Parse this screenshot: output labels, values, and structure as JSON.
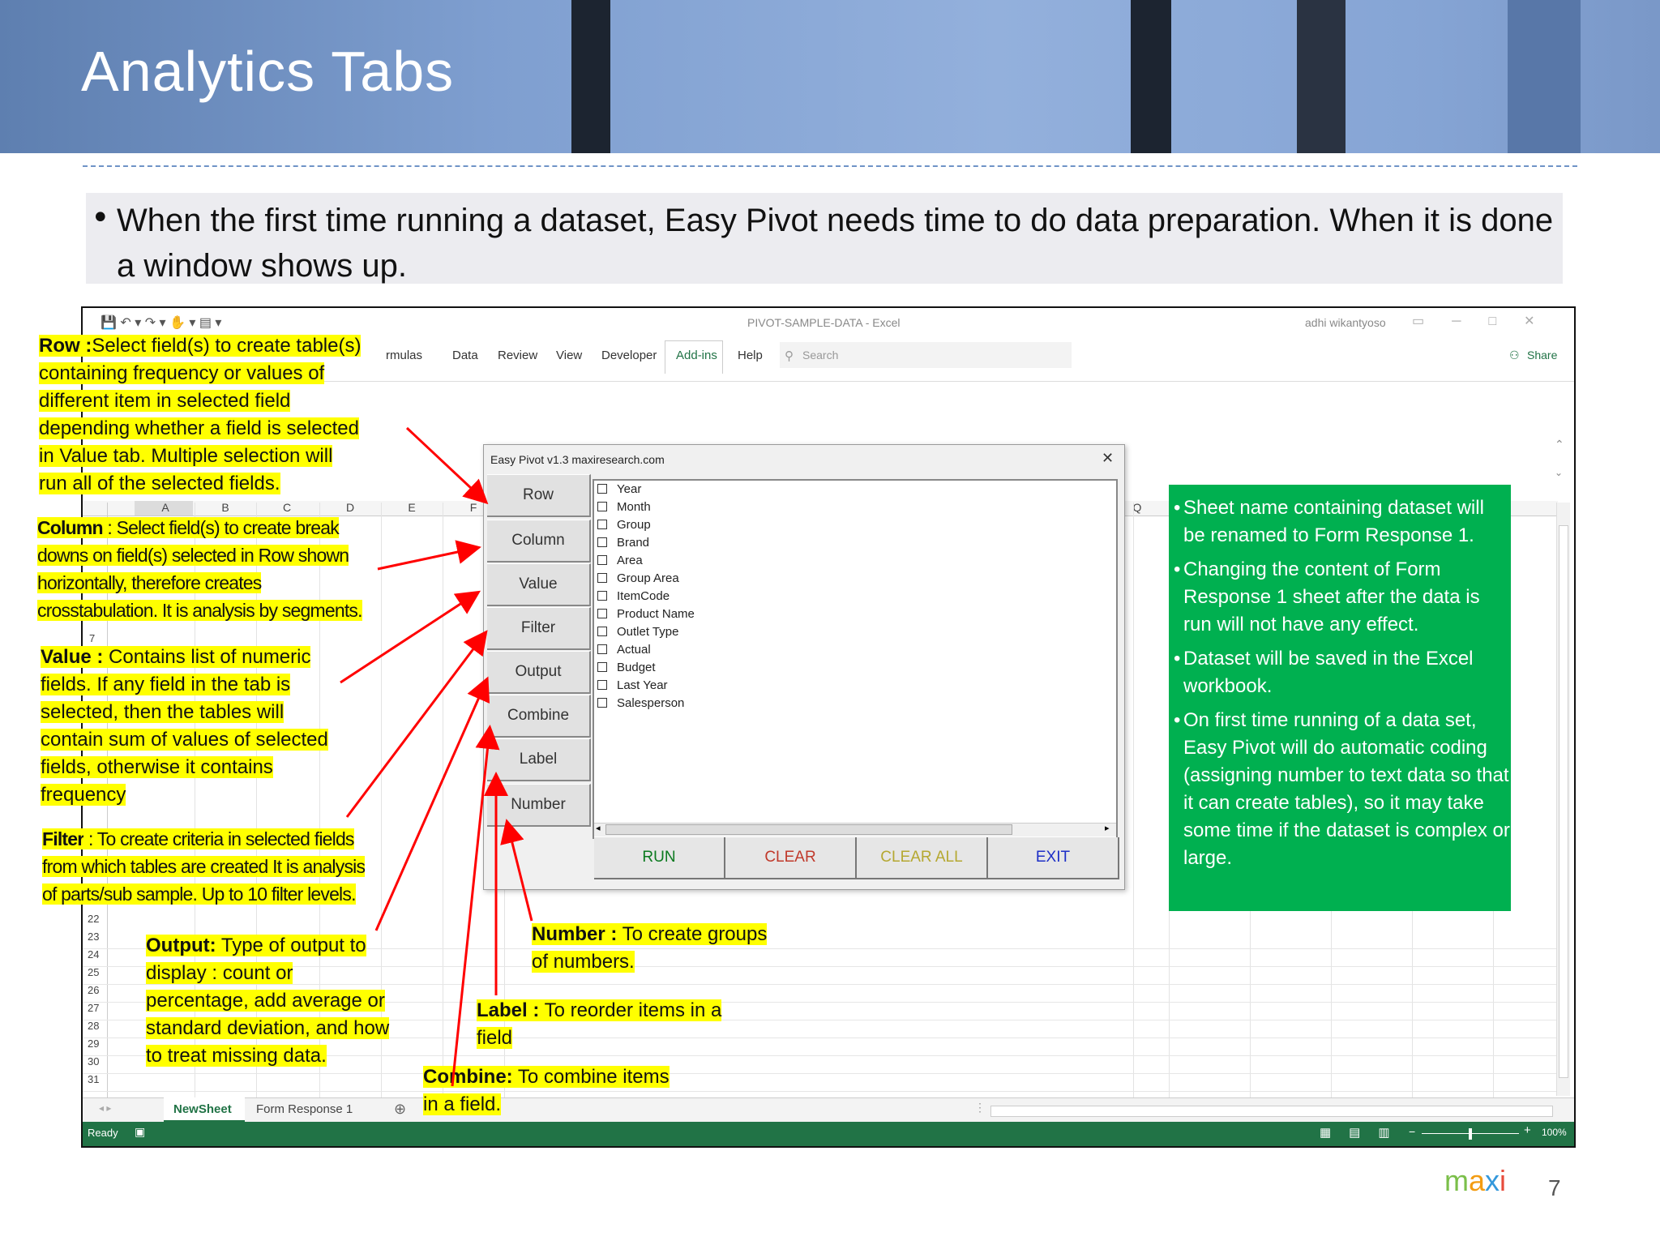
{
  "slide": {
    "title": "Analytics Tabs",
    "bullet": "When the first time running a dataset, Easy Pivot needs time to do data preparation.  When it is done a window shows up.",
    "page_number": "7",
    "logo": {
      "m": "m",
      "a": "a",
      "x": "x",
      "i": "i"
    }
  },
  "excel": {
    "window_title": "PIVOT-SAMPLE-DATA  -  Excel",
    "user": "adhi wikantyoso",
    "menu": [
      "rmulas",
      "Data",
      "Review",
      "View",
      "Developer",
      "Add-ins",
      "Help"
    ],
    "search_placeholder": "Search",
    "share": "Share",
    "columns": [
      "A",
      "B",
      "C",
      "D",
      "E",
      "F"
    ],
    "col_q": "Q",
    "row_numbers": [
      "7",
      "22",
      "23",
      "24",
      "25",
      "26",
      "27",
      "28",
      "29",
      "30",
      "31"
    ],
    "sheet_tabs": [
      "NewSheet",
      "Form Response 1"
    ],
    "status": "Ready",
    "zoom": "100%"
  },
  "dialog": {
    "title": "Easy Pivot v1.3  maxiresearch.com",
    "close": "✕",
    "tabs": [
      "Row",
      "Column",
      "Value",
      "Filter",
      "Output",
      "Combine",
      "Label",
      "Number"
    ],
    "fields": [
      "Year",
      "Month",
      "Group",
      "Brand",
      "Area",
      "Group Area",
      "ItemCode",
      "Product Name",
      "Outlet Type",
      "Actual",
      "Budget",
      "Last Year",
      "Salesperson"
    ],
    "actions": {
      "run": "RUN",
      "clear": "CLEAR",
      "clear_all": "CLEAR ALL",
      "exit": "EXIT"
    }
  },
  "callouts": {
    "row": {
      "label": "Row :",
      "lines": [
        "Select field(s) to create table(s)",
        "containing frequency or values of",
        "different item in selected field",
        "depending whether  a field is selected",
        "in Value tab.  Multiple selection will",
        "run all  of the selected fields."
      ]
    },
    "column": {
      "label": "Column",
      "lines": [
        " : Select field(s) to create break",
        "downs on field(s) selected in Row shown",
        "horizontally, therefore creates",
        "crosstabulation. It is analysis by segments."
      ]
    },
    "value": {
      "label": "Value :",
      "lines": [
        " Contains list of numeric",
        "fields. If any field in the tab is",
        "selected,  then  the tables will",
        "contain sum of values of selected",
        "fields, otherwise it contains",
        "frequency"
      ]
    },
    "filter": {
      "label": "Filter",
      "lines": [
        " :  To create criteria in selected fields",
        "from which tables are created  It is analysis",
        "of parts/sub sample. Up to 10 filter levels."
      ]
    },
    "output": {
      "label": "Output:",
      "lines": [
        " Type  of output to",
        "display : count or",
        "percentage,  add average or",
        "standard deviation, and how",
        "to treat missing data."
      ]
    },
    "number": {
      "label": "Number  :",
      "lines": [
        " To create groups",
        "of numbers."
      ]
    },
    "label": {
      "label": "Label  :",
      "lines": [
        " To reorder items in a",
        "field"
      ]
    },
    "combine": {
      "label": "Combine:",
      "lines": [
        " To combine items",
        "in a field."
      ]
    }
  },
  "notes": [
    "Sheet  name containing dataset will be renamed to Form Response 1.",
    "Changing the content  of Form Response 1 sheet after the data is run will not have any effect.",
    "Dataset will be saved in the Excel workbook.",
    "On first time running of a data set, Easy Pivot will do automatic coding (assigning number to text data so that it can create tables), so it may take some time if the dataset is complex or large."
  ],
  "colors": {
    "callout": "#ffff00",
    "arrow": "#ff0000",
    "note_bg": "#00b050",
    "excel_green": "#217346"
  }
}
